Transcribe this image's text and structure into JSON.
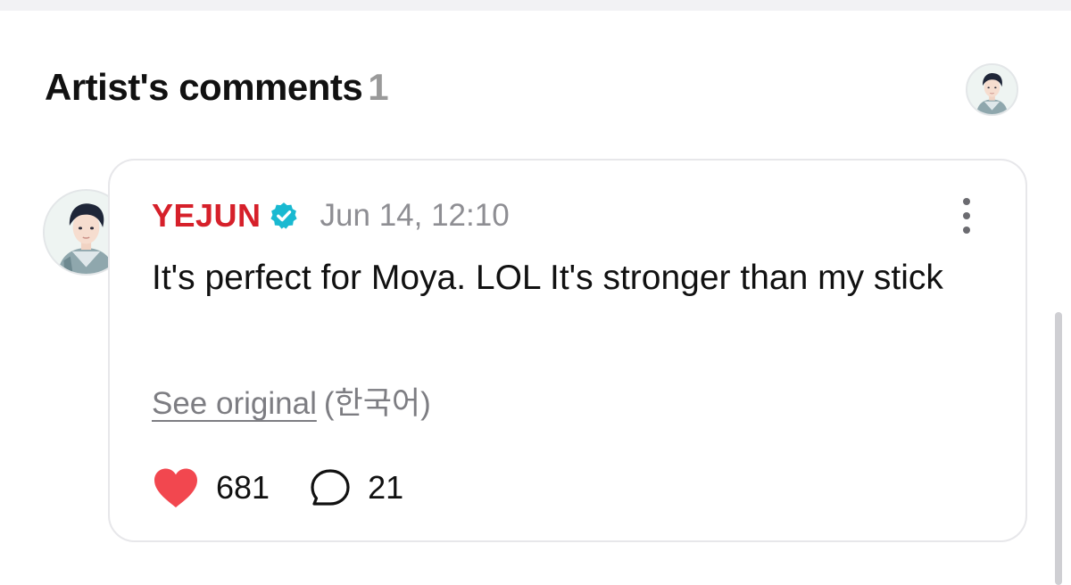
{
  "header": {
    "title": "Artist's comments",
    "count": "1"
  },
  "comment": {
    "author": "YEJUN",
    "timestamp": "Jun 14, 12:10",
    "text": "It's perfect for Moya. LOL It's stronger than my stick",
    "see_original_label": "See original",
    "original_language": "(한국어)",
    "likes": "681",
    "replies": "21"
  },
  "colors": {
    "author": "#d6202a",
    "verified_badge": "#19b9d1",
    "heart": "#f2474f",
    "muted_text": "#8e8e93"
  },
  "icons": {
    "verified": "verified-badge-icon",
    "more": "more-vertical-icon",
    "like": "heart-icon",
    "reply": "comment-bubble-icon"
  }
}
